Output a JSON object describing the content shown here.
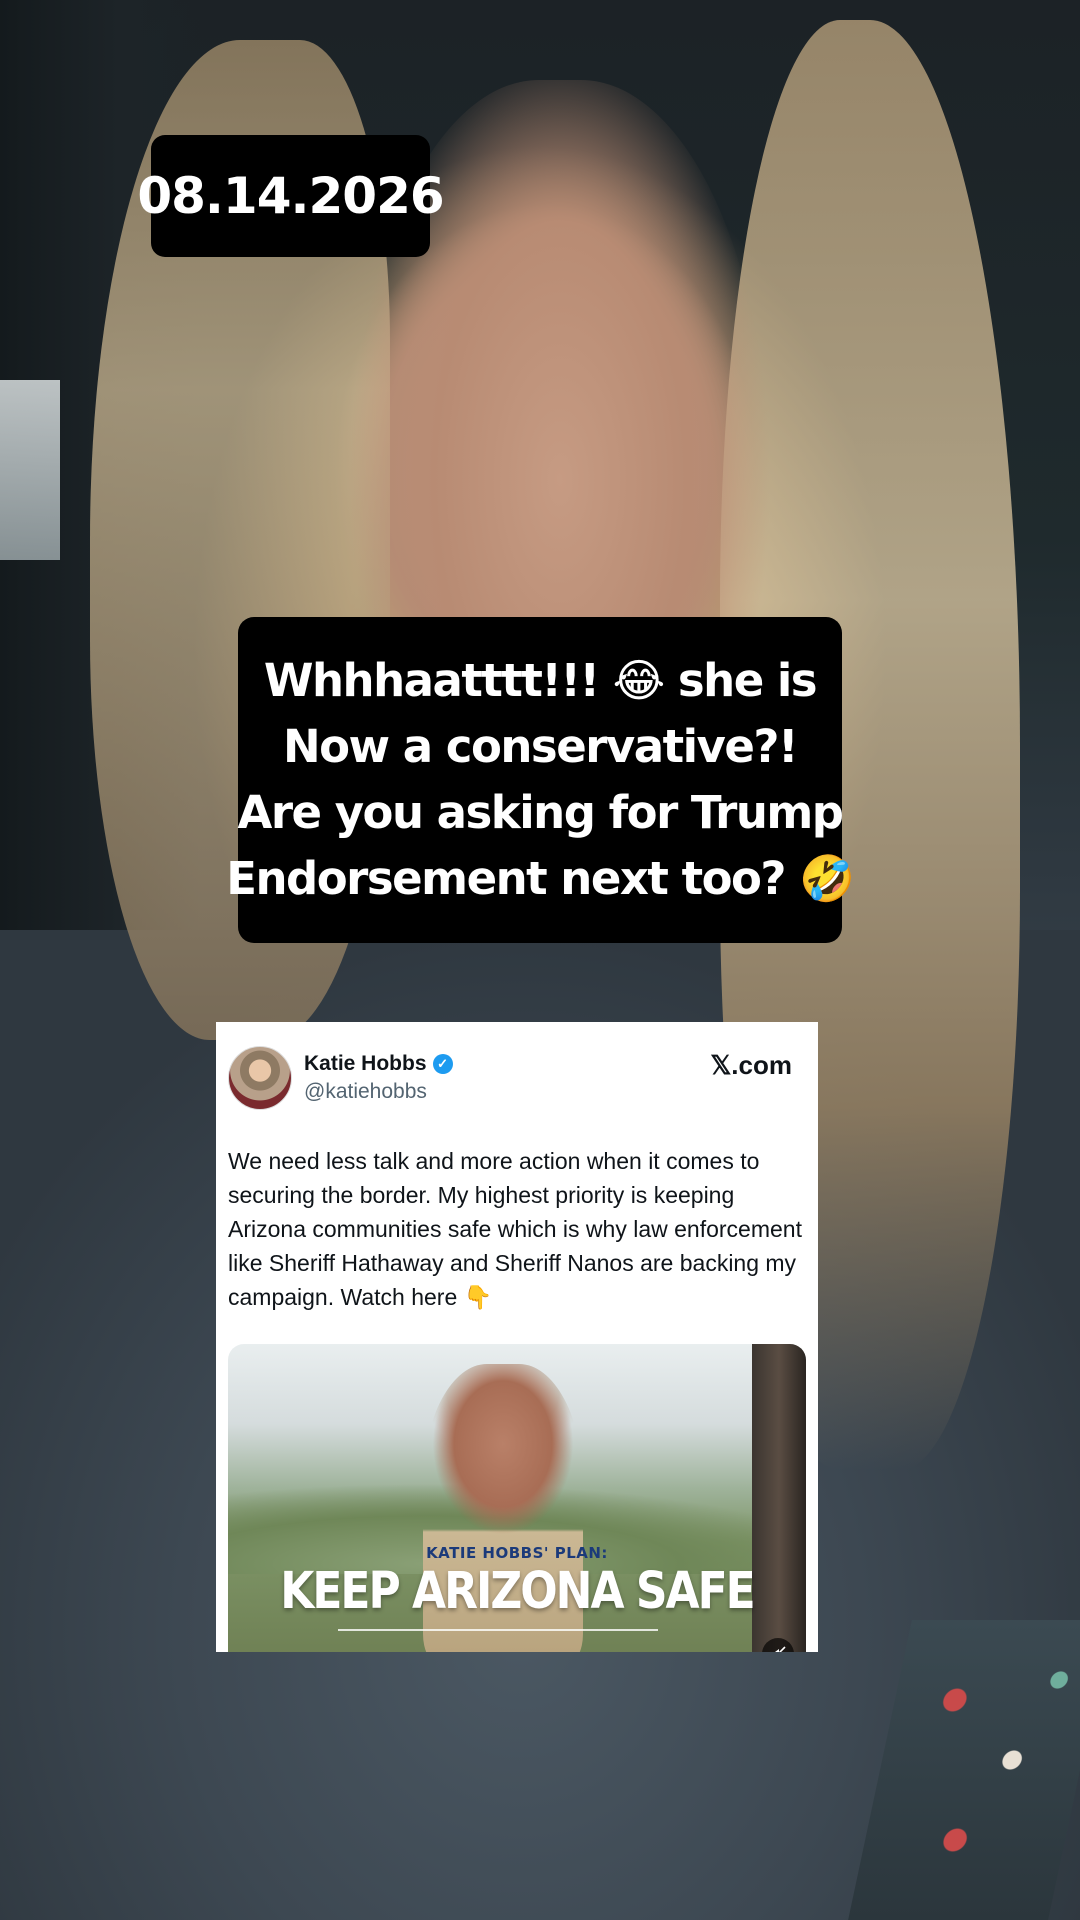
{
  "date_badge": "08.14.2026",
  "caption": {
    "line1": "Whhhaatttt!!! 😂 she is",
    "line2": "Now a conservative?!",
    "line3": "Are you asking for Trump",
    "line4": "Endorsement next too? 🤣"
  },
  "tweet": {
    "author_name": "Katie Hobbs",
    "handle": "@katiehobbs",
    "source": "𝕏.com",
    "text": "We need less talk and more action when it comes to securing the border. My highest priority is keeping Arizona communities safe which is why law enforcement like Sheriff Hathaway and Sheriff Nanos are backing my campaign. Watch here 👇",
    "media": {
      "subtitle": "KATIE HOBBS' PLAN:",
      "title": "KEEP ARIZONA SAFE"
    }
  },
  "icons": {
    "verified": "verified-badge-icon",
    "mute": "muted-speaker-icon"
  },
  "colors": {
    "verified_blue": "#1d9bf0",
    "overlay_bg": "#000000"
  }
}
